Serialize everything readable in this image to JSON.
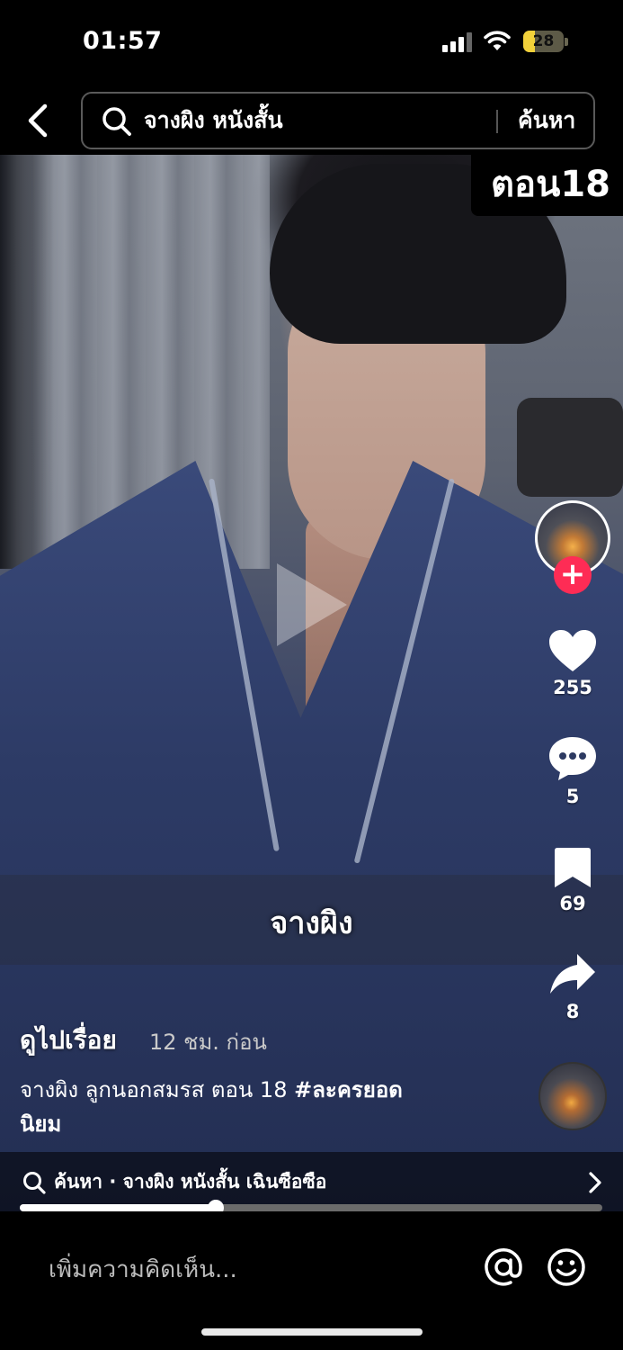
{
  "status_bar": {
    "time": "01:57",
    "battery_level": "28",
    "battery_fraction": 0.28,
    "battery_color": "#f2d13a"
  },
  "header": {
    "back_icon": "chevron-left-icon",
    "search_icon": "search-icon",
    "search_query": "จางผิง หนังสั้น",
    "search_button": "ค้นหา"
  },
  "video": {
    "episode_badge": "ตอน18",
    "subtitle": "จางผิง",
    "play_icon": "play-icon"
  },
  "actions": {
    "follow_icon": "plus-icon",
    "likes": "255",
    "comments": "5",
    "bookmarks": "69",
    "shares": "8",
    "accent_color": "#fe2c55"
  },
  "post": {
    "author": "ดูไปเรื่อย",
    "time_ago": "12 ชม. ก่อน",
    "description": "จางผิง ลูกนอกสมรส ตอน 18 ",
    "hashtag": "#ละครยอดนิยม"
  },
  "suggestion": {
    "text": "ค้นหา · จางผิง หนังสั้น เฉินซือซือ"
  },
  "playback": {
    "progress": 0.337
  },
  "comment_bar": {
    "placeholder": "เพิ่มความคิดเห็น...",
    "mention_icon": "at-icon",
    "emoji_icon": "emoji-icon"
  }
}
